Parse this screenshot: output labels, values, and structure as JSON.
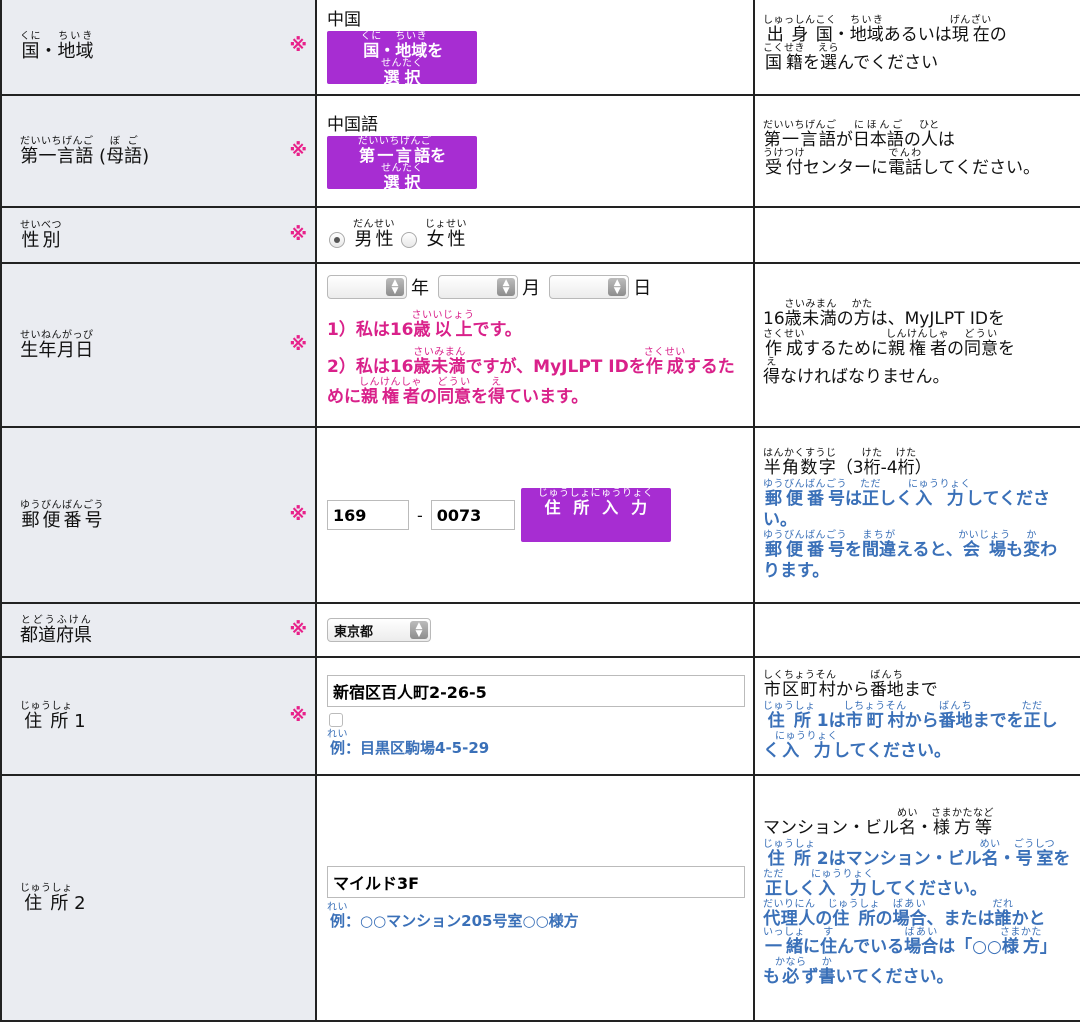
{
  "required_mark": "※",
  "rows": {
    "country": {
      "label": [
        {
          "rb": "国",
          "rt": "くに"
        },
        {
          "t": "・"
        },
        {
          "rb": "地域",
          "rt": "ちいき"
        }
      ],
      "value": "中国",
      "button": [
        {
          "rb": "国",
          "rt": "くに"
        },
        {
          "t": "・"
        },
        {
          "rb": "地域",
          "rt": "ちいき"
        },
        {
          "t": "を"
        },
        {
          "br": true
        },
        {
          "rb": "選択",
          "rt": "せんたく"
        }
      ],
      "note": [
        {
          "rb": "出身国",
          "rt": "しゅっしんこく"
        },
        {
          "t": "・"
        },
        {
          "rb": "地域",
          "rt": "ちいき"
        },
        {
          "t": "あるいは"
        },
        {
          "rb": "現在",
          "rt": "げんざい"
        },
        {
          "t": "の"
        },
        {
          "br": true
        },
        {
          "rb": "国籍",
          "rt": "こくせき"
        },
        {
          "t": "を"
        },
        {
          "rb": "選",
          "rt": "えら"
        },
        {
          "t": "んでください"
        }
      ]
    },
    "language": {
      "label": [
        {
          "rb": "第一言語",
          "rt": "だいいちげんご"
        },
        {
          "t": " ("
        },
        {
          "rb": "母語",
          "rt": "ぼご"
        },
        {
          "t": ")"
        }
      ],
      "value": "中国語",
      "button": [
        {
          "rb": "第一言語",
          "rt": "だいいちげんご"
        },
        {
          "t": "を"
        },
        {
          "br": true
        },
        {
          "rb": "選択",
          "rt": "せんたく"
        }
      ],
      "note": [
        {
          "rb": "第一言語",
          "rt": "だいいちげんご"
        },
        {
          "t": "が"
        },
        {
          "rb": "日本語",
          "rt": "にほんご"
        },
        {
          "t": "の"
        },
        {
          "rb": "人",
          "rt": "ひと"
        },
        {
          "t": "は"
        },
        {
          "br": true
        },
        {
          "rb": "受付",
          "rt": "うけつけ"
        },
        {
          "t": "センターに"
        },
        {
          "rb": "電話",
          "rt": "でんわ"
        },
        {
          "t": "してください。"
        }
      ]
    },
    "gender": {
      "label": [
        {
          "rb": "性別",
          "rt": "せいべつ"
        }
      ],
      "male": [
        {
          "rb": "男性",
          "rt": "だんせい"
        }
      ],
      "female": [
        {
          "rb": "女性",
          "rt": "じょせい"
        }
      ]
    },
    "birthdate": {
      "label": [
        {
          "rb": "生年月日",
          "rt": "せいねんがっぴ"
        }
      ],
      "year": "年",
      "month": "月",
      "day": "日",
      "option1": [
        {
          "t": "1）私は16"
        },
        {
          "rb": "歳",
          "rt": "さい"
        },
        {
          "rb": "以上",
          "rt": "いじょう"
        },
        {
          "t": "です。"
        }
      ],
      "option2": [
        {
          "t": "2）私は16"
        },
        {
          "rb": "歳未満",
          "rt": "さいみまん"
        },
        {
          "t": "ですが、MyJLPT IDを"
        },
        {
          "rb": "作成",
          "rt": "さくせい"
        },
        {
          "t": "するために"
        },
        {
          "rb": "親権者",
          "rt": "しんけんしゃ"
        },
        {
          "t": "の"
        },
        {
          "rb": "同意",
          "rt": "どうい"
        },
        {
          "t": "を"
        },
        {
          "rb": "得",
          "rt": "え"
        },
        {
          "t": "ています。"
        }
      ],
      "note": [
        {
          "t": "16"
        },
        {
          "rb": "歳未満",
          "rt": "さいみまん"
        },
        {
          "t": "の"
        },
        {
          "rb": "方",
          "rt": "かた"
        },
        {
          "t": "は、MyJLPT IDを"
        },
        {
          "br": true
        },
        {
          "rb": "作成",
          "rt": "さくせい"
        },
        {
          "t": "するために"
        },
        {
          "rb": "親権者",
          "rt": "しんけんしゃ"
        },
        {
          "t": "の"
        },
        {
          "rb": "同意",
          "rt": "どうい"
        },
        {
          "t": "を"
        },
        {
          "br": true
        },
        {
          "rb": "得",
          "rt": "え"
        },
        {
          "t": "なければなりません。"
        }
      ]
    },
    "postal": {
      "label": [
        {
          "rb": "郵便番号",
          "rt": "ゆうびんばんごう"
        }
      ],
      "part1": "169",
      "separator": "-",
      "part2": "0073",
      "button": [
        {
          "rb": "住所入力",
          "rt": "じゅうしょにゅうりょく"
        }
      ],
      "note_black": [
        {
          "rb": "半角数字",
          "rt": "はんかくすうじ"
        },
        {
          "t": "（3"
        },
        {
          "rb": "桁",
          "rt": "けた"
        },
        {
          "t": "-4"
        },
        {
          "rb": "桁",
          "rt": "けた"
        },
        {
          "t": "）"
        }
      ],
      "note_blue1": [
        {
          "rb": "郵便",
          "rt": "ゆうびん"
        },
        {
          "rb": "番号",
          "rt": "ばんごう"
        },
        {
          "t": "は"
        },
        {
          "rb": "正",
          "rt": "ただ"
        },
        {
          "t": "しく"
        },
        {
          "rb": "入力",
          "rt": "にゅうりょく"
        },
        {
          "t": "してください。"
        }
      ],
      "note_blue2": [
        {
          "rb": "郵便番号",
          "rt": "ゆうびんばんごう"
        },
        {
          "t": "を"
        },
        {
          "rb": "間違",
          "rt": "まちが"
        },
        {
          "t": "えると、"
        },
        {
          "rb": "会場",
          "rt": "かいじょう"
        },
        {
          "t": "も"
        },
        {
          "rb": "変",
          "rt": "か"
        },
        {
          "t": "わります。"
        }
      ]
    },
    "prefecture": {
      "label": [
        {
          "rb": "都道府県",
          "rt": "とどうふけん"
        }
      ],
      "value": "東京都"
    },
    "address1": {
      "label": [
        {
          "rb": "住所",
          "rt": "じゅうしょ"
        },
        {
          "t": " 1"
        }
      ],
      "value": "新宿区百人町2-26-5",
      "example": [
        {
          "rb": "例",
          "rt": "れい"
        },
        {
          "t": "：目黒区駒場4-5-29"
        }
      ],
      "note_black": [
        {
          "rb": "市区町村",
          "rt": "しくちょうそん"
        },
        {
          "t": "から"
        },
        {
          "rb": "番地",
          "rt": "ばんち"
        },
        {
          "t": "まで"
        }
      ],
      "note_blue": [
        {
          "rb": "住所",
          "rt": "じゅうしょ"
        },
        {
          "t": " 1は"
        },
        {
          "rb": "市町村",
          "rt": "しちょうそん"
        },
        {
          "t": "から"
        },
        {
          "rb": "番地",
          "rt": "ばんち"
        },
        {
          "t": "までを"
        },
        {
          "rb": "正",
          "rt": "ただ"
        },
        {
          "t": "しく"
        },
        {
          "rb": "入力",
          "rt": "にゅうりょく"
        },
        {
          "t": "してください。"
        }
      ]
    },
    "address2": {
      "label": [
        {
          "rb": "住所",
          "rt": "じゅうしょ"
        },
        {
          "t": " 2"
        }
      ],
      "value": "マイルド3F",
      "example": [
        {
          "rb": "例",
          "rt": "れい"
        },
        {
          "t": "：○○マンション205号室○○様方"
        }
      ],
      "note_black": [
        {
          "t": "マンション・ビル"
        },
        {
          "rb": "名",
          "rt": "めい"
        },
        {
          "t": "・"
        },
        {
          "rb": "様方等",
          "rt": "さまかたなど"
        }
      ],
      "note_blue1": [
        {
          "rb": "住所",
          "rt": "じゅうしょ"
        },
        {
          "t": " 2はマンション・ビル"
        },
        {
          "rb": "名",
          "rt": "めい"
        },
        {
          "t": "・"
        },
        {
          "rb": "号室",
          "rt": "ごうしつ"
        },
        {
          "t": "を"
        },
        {
          "rb": "正",
          "rt": "ただ"
        },
        {
          "t": "しく"
        },
        {
          "rb": "入力",
          "rt": "にゅうりょく"
        },
        {
          "t": "してください。"
        }
      ],
      "note_blue2": [
        {
          "rb": "代理人",
          "rt": "だいりにん"
        },
        {
          "t": "の"
        },
        {
          "rb": "住所",
          "rt": "じゅうしょ"
        },
        {
          "t": "の"
        },
        {
          "rb": "場合",
          "rt": "ばあい"
        },
        {
          "t": "、または"
        },
        {
          "rb": "誰",
          "rt": "だれ"
        },
        {
          "t": "かと"
        },
        {
          "rb": "一緒",
          "rt": "いっしょ"
        },
        {
          "t": "に"
        },
        {
          "rb": "住",
          "rt": "す"
        },
        {
          "t": "んでいる"
        },
        {
          "rb": "場合",
          "rt": "ばあい"
        },
        {
          "t": "は「○○"
        },
        {
          "rb": "様方",
          "rt": "さまかた"
        },
        {
          "t": "」も"
        },
        {
          "rb": "必",
          "rt": "かなら"
        },
        {
          "t": "ず"
        },
        {
          "rb": "書",
          "rt": "か"
        },
        {
          "t": "いてください。"
        }
      ]
    }
  }
}
